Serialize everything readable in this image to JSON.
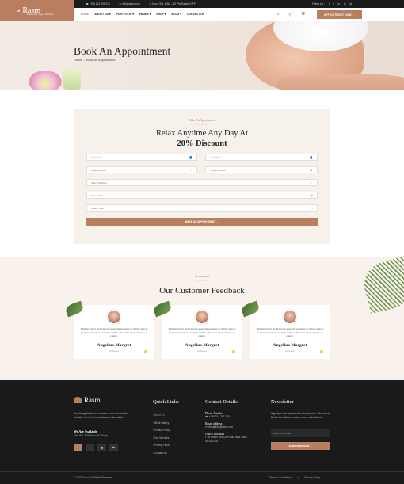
{
  "brand": {
    "name": "Rasm",
    "tagline": "Beauty Spa Yoga & Wellness"
  },
  "topbar": {
    "phone": "+256 214 203 215",
    "email": "info@rasm.com",
    "hours": "Mon - Sat: 8 AM – 10 PM Sunday OFF",
    "follow_label": "Follow Us :",
    "socials": [
      "f",
      "t",
      "in",
      "ig",
      "yt"
    ]
  },
  "nav": {
    "items": [
      "HOME",
      "ABOUT US",
      "PORTFOLIO",
      "PAGES",
      "SHOP",
      "BLOG",
      "CONTACT US"
    ],
    "active_index": 0,
    "cart_count": "0",
    "appointment_button": "APPOINTMENT NOW →"
  },
  "hero": {
    "title": "Book An Appointment",
    "breadcrumb_home": "Home",
    "breadcrumb_current": "Book An Appointment"
  },
  "form": {
    "sub_label": "Make An Appointment",
    "title_line1": "Relax Anytime Any Day At",
    "title_line2": "20% Discount",
    "first_name_placeholder": "First Name",
    "last_name_placeholder": "Last Name",
    "email_placeholder": "Email Address",
    "phone_placeholder": "Phone Number",
    "solution_placeholder": "Select Solution",
    "date_placeholder": "Select Date",
    "time_placeholder": "Select Time",
    "submit_label": "MAKE AN APPOINTMENT →"
  },
  "testimonials": {
    "sub_label": "Testimonials",
    "title": "Our Customer Feedback",
    "cards": [
      {
        "quote": "Whether you're preparing for a special occasion or simply want to pamper yourself our talented stylists will work closely with you to ensure.",
        "name": "Angelina Margret",
        "role": "Customer"
      },
      {
        "quote": "Whether you're preparing for a special occasion or simply want to pamper yourself our talented stylists will work closely with you to ensure.",
        "name": "Angelina Margret",
        "role": "Customer"
      },
      {
        "quote": "Whether you're preparing for a special occasion or simply want to pamper yourself our talented stylists will work closely with you to ensure.",
        "name": "Angelina Margret",
        "role": "Customer"
      }
    ]
  },
  "footer": {
    "description": "Centric applications productize front end portals visualize front end is results and value added",
    "available_title": "We Are Available",
    "hours": "Mon-Sat: 8:00 am to 10:00 pm",
    "socials": [
      "f",
      "t",
      "ig",
      "in"
    ],
    "quick_links_title": "Quick Links",
    "quick_links": [
      "About Us",
      "Work Gallery",
      "Privacy Policy",
      "Our Services",
      "Pricing Plans",
      "Contact Us"
    ],
    "contact_title": "Contact Details",
    "contact": [
      {
        "label": "Phone Number",
        "value": "+256 214 203 215"
      },
      {
        "label": "Email address",
        "value": "help@info@rasm.com"
      },
      {
        "label": "Office Location",
        "value": "25 Street, MS City Road New Town DCSL USA"
      }
    ],
    "newsletter_title": "Newsletter",
    "newsletter_text": "Sign Up to get updates & news about us . Get Latest Deals from Walker's Inbox to our mail address.",
    "email_placeholder": "Enter your email",
    "subscribe_label": "SUBSCRIBE NOW →",
    "copyright_prefix": "© 2022",
    "copyright_brand": "Rasm",
    "copyright_suffix": ", All Rights Reserved.",
    "bottom_links": [
      "Terms & Conditions",
      "Privacy Policy"
    ]
  },
  "colors": {
    "accent": "#b97e5f",
    "dark": "#1a1a1a",
    "cream": "#f7f1ec"
  }
}
